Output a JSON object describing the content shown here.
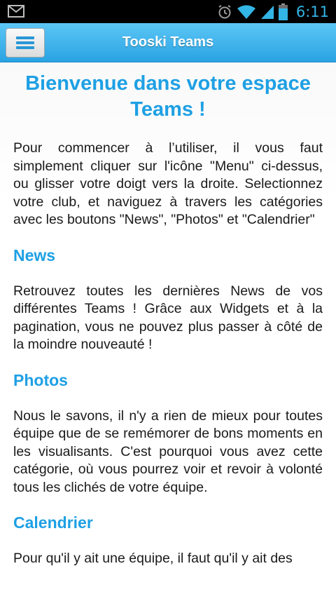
{
  "status_bar": {
    "left_icons": [
      "gmail-icon"
    ],
    "right_icons": [
      "alarm-icon",
      "wifi-icon",
      "signal-icon",
      "battery-icon"
    ],
    "time": "6:11"
  },
  "header": {
    "menu_icon": "hamburger-menu-icon",
    "title": "Tooski Teams",
    "colors": {
      "bar": "#2aa3e3",
      "title_text": "#ffffff"
    }
  },
  "content": {
    "welcome_title": "Bienvenue dans votre espace Teams !",
    "intro": "Pour commencer à l’utiliser, il vous faut simplement cliquer sur l'icône \"Menu\" ci-dessus, ou glisser votre doigt vers la droite. Selectionnez votre club, et naviguez à travers les catégories avec les boutons \"News\", \"Photos\" et \"Calendrier\"",
    "sections": [
      {
        "heading": "News",
        "text": "Retrouvez toutes les dernières News de vos différentes Teams ! Grâce aux Widgets et à la pagination, vous ne pouvez plus passer à côté de la moindre nouveauté !"
      },
      {
        "heading": "Photos",
        "text": "Nous le savons, il n'y a rien de mieux pour toutes équipe que de se remémorer de bons moments en les visualisants. C'est pourquoi vous avez cette catégorie, où vous pourrez voir et revoir à volonté tous les clichés de votre équipe."
      },
      {
        "heading": "Calendrier",
        "text": "Pour qu'il y ait une équipe, il faut qu'il y ait des"
      }
    ],
    "colors": {
      "heading": "#1ea0e4",
      "body_text": "#1a1a1a"
    }
  }
}
